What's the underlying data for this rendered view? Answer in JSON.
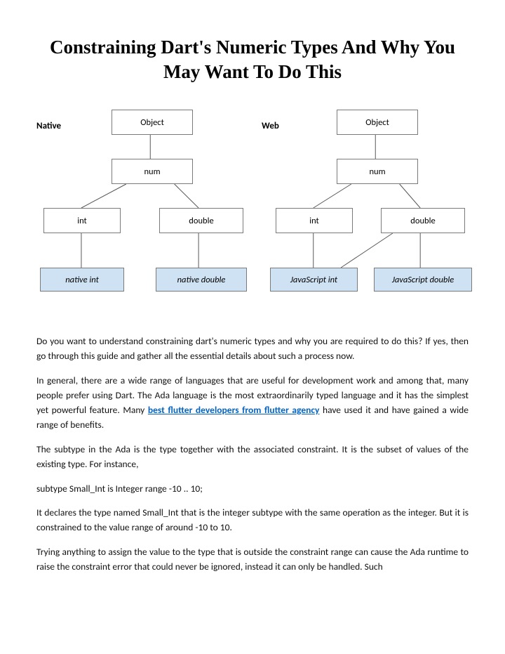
{
  "title": "Constraining Dart's Numeric Types And Why You May Want To Do This",
  "diagram": {
    "native": {
      "label": "Native",
      "object": "Object",
      "num": "num",
      "int": "int",
      "double": "double",
      "leaf_int": "native int",
      "leaf_double": "native double"
    },
    "web": {
      "label": "Web",
      "object": "Object",
      "num": "num",
      "int": "int",
      "double": "double",
      "leaf_int": "JavaScript int",
      "leaf_double": "JavaScript double"
    }
  },
  "paragraphs": {
    "p1": "Do you want to understand constraining dart's numeric types and why you are required to do this? If yes, then go through this guide and gather all the essential details about such a process now.",
    "p2a": "In general, there are a wide range of languages that are useful for development work and among that, many people prefer using Dart. The Ada language is the most extraordinarily typed language and it has the simplest yet powerful feature. Many ",
    "p2_link": "best flutter developers from flutter agency",
    "p2b": " have used it and have gained a wide range of benefits.",
    "p3": "The subtype in the Ada is the type together with the associated constraint. It is the subset of values of the existing type. For instance,",
    "p4": "subtype Small_Int is Integer range -10 .. 10;",
    "p5": "It declares the type named Small_Int that is the integer subtype with the same operation as the integer. But it is constrained to the value range of around -10 to 10.",
    "p6": "Trying anything to assign the value to the type that is outside the constraint range can cause the Ada runtime to raise the constraint error that could never be ignored, instead it can only be handled. Such"
  }
}
